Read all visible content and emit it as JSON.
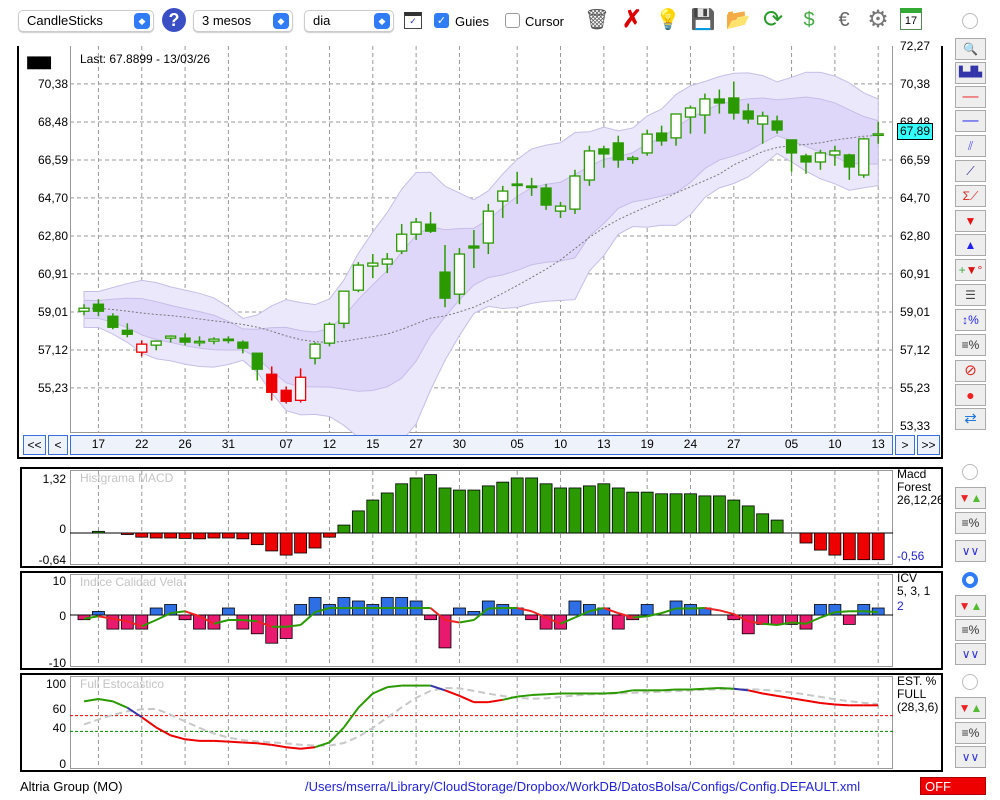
{
  "toolbar": {
    "chart_type": "CandleSticks",
    "period": "3 mesos",
    "interval": "dia",
    "guides_label": "Guies",
    "guides_checked": true,
    "cursor_label": "Cursor",
    "cursor_checked": false,
    "icons": [
      "trash-icon",
      "delete-icon",
      "lamp-icon",
      "save-icon",
      "open-folder-icon",
      "refresh-icon",
      "dollar-refresh-icon",
      "euro-icon",
      "gear-icon",
      "calendar-icon"
    ],
    "calendar_day": "17"
  },
  "main": {
    "last_label": "Last: 67.8899 - 13/03/26",
    "current_price": "67,89",
    "price_ticks": [
      72.27,
      70.38,
      68.48,
      66.59,
      64.7,
      62.8,
      60.91,
      59.01,
      57.12,
      55.23,
      53.33
    ],
    "price_tick_labels": [
      "72,27",
      "70,38",
      "68,48",
      "66,59",
      "64,70",
      "62,80",
      "60,91",
      "59,01",
      "57,12",
      "55,23",
      "53,33"
    ],
    "nav": {
      "first": "<<",
      "prev": "<",
      "next": ">",
      "last": ">>"
    },
    "date_ticks": [
      {
        "label": "17",
        "i": 1
      },
      {
        "label": "22",
        "i": 4
      },
      {
        "label": "26",
        "i": 7
      },
      {
        "label": "31",
        "i": 10
      },
      {
        "label": "07",
        "i": 14
      },
      {
        "label": "12",
        "i": 17
      },
      {
        "label": "15",
        "i": 20
      },
      {
        "label": "27",
        "i": 23
      },
      {
        "label": "30",
        "i": 26
      },
      {
        "label": "05",
        "i": 30
      },
      {
        "label": "10",
        "i": 33
      },
      {
        "label": "13",
        "i": 36
      },
      {
        "label": "19",
        "i": 39
      },
      {
        "label": "24",
        "i": 42
      },
      {
        "label": "27",
        "i": 45
      },
      {
        "label": "05",
        "i": 49
      },
      {
        "label": "10",
        "i": 52
      },
      {
        "label": "13",
        "i": 55
      }
    ]
  },
  "chart_data": {
    "type": "candlestick",
    "ylim": [
      53.33,
      72.27
    ],
    "colors": {
      "up": "#2a9a00",
      "down": "#ee0000",
      "band_outer": "#ece8fc",
      "band_inner": "#dfd7fa"
    },
    "candles": [
      [
        59.05,
        59.2,
        59.4,
        58.85,
        "g"
      ],
      [
        59.4,
        59.05,
        59.65,
        58.8,
        "g"
      ],
      [
        58.8,
        58.25,
        58.95,
        58.15,
        "g"
      ],
      [
        58.1,
        57.9,
        58.45,
        57.75,
        "g"
      ],
      [
        57.01,
        57.41,
        57.6,
        56.8,
        "r"
      ],
      [
        57.36,
        57.56,
        57.6,
        57.1,
        "g"
      ],
      [
        57.71,
        57.81,
        57.85,
        57.5,
        "g"
      ],
      [
        57.71,
        57.51,
        57.95,
        57.35,
        "g"
      ],
      [
        57.51,
        57.55,
        57.8,
        57.3,
        "g"
      ],
      [
        57.56,
        57.66,
        57.75,
        57.4,
        "g"
      ],
      [
        57.66,
        57.61,
        57.8,
        57.45,
        "g"
      ],
      [
        57.51,
        57.21,
        57.6,
        56.95,
        "g"
      ],
      [
        56.96,
        56.16,
        56.96,
        55.6,
        "g"
      ],
      [
        55.91,
        55.01,
        56.3,
        54.6,
        "r"
      ],
      [
        55.11,
        54.56,
        55.3,
        54.45,
        "r"
      ],
      [
        54.61,
        55.76,
        56.2,
        54.5,
        "r"
      ],
      [
        56.71,
        57.41,
        57.5,
        56.4,
        "g"
      ],
      [
        57.46,
        58.4,
        58.5,
        57.3,
        "g"
      ],
      [
        58.45,
        60.05,
        60.05,
        58.2,
        "g"
      ],
      [
        60.1,
        61.35,
        61.5,
        60.0,
        "g"
      ],
      [
        61.3,
        61.45,
        61.9,
        60.7,
        "g"
      ],
      [
        61.4,
        61.65,
        61.95,
        60.95,
        "g"
      ],
      [
        62.05,
        62.89,
        63.4,
        61.9,
        "g"
      ],
      [
        62.89,
        63.49,
        63.7,
        62.6,
        "g"
      ],
      [
        63.39,
        63.04,
        64.0,
        62.95,
        "g"
      ],
      [
        61.0,
        59.7,
        62.35,
        59.25,
        "g"
      ],
      [
        59.9,
        61.9,
        62.2,
        59.4,
        "g"
      ],
      [
        62.3,
        62.2,
        63.1,
        61.2,
        "g"
      ],
      [
        62.45,
        64.04,
        64.4,
        61.9,
        "g"
      ],
      [
        64.54,
        65.04,
        65.3,
        63.7,
        "g"
      ],
      [
        65.39,
        65.34,
        66.0,
        64.4,
        "g"
      ],
      [
        65.29,
        65.27,
        65.7,
        64.8,
        "g"
      ],
      [
        65.19,
        64.34,
        65.4,
        64.1,
        "g"
      ],
      [
        64.04,
        64.29,
        64.5,
        63.7,
        "g"
      ],
      [
        64.14,
        65.79,
        66.1,
        63.9,
        "g"
      ],
      [
        65.59,
        67.04,
        67.3,
        65.3,
        "g"
      ],
      [
        67.14,
        66.89,
        67.3,
        66.2,
        "g"
      ],
      [
        67.44,
        66.59,
        67.8,
        66.2,
        "g"
      ],
      [
        66.64,
        66.69,
        66.8,
        66.4,
        "g"
      ],
      [
        66.94,
        67.88,
        68.1,
        66.8,
        "g"
      ],
      [
        67.93,
        67.54,
        68.3,
        67.3,
        "g"
      ],
      [
        67.69,
        68.88,
        68.9,
        67.3,
        "g"
      ],
      [
        68.73,
        69.18,
        69.3,
        67.9,
        "g"
      ],
      [
        68.83,
        69.63,
        69.9,
        67.9,
        "g"
      ],
      [
        69.63,
        69.43,
        70.1,
        68.9,
        "g"
      ],
      [
        69.68,
        68.93,
        70.5,
        68.6,
        "g"
      ],
      [
        69.03,
        68.63,
        69.4,
        68.4,
        "g"
      ],
      [
        68.38,
        68.78,
        69.0,
        67.4,
        "g"
      ],
      [
        68.53,
        68.08,
        68.8,
        67.9,
        "g"
      ],
      [
        67.59,
        66.94,
        67.6,
        66.0,
        "g"
      ],
      [
        66.79,
        66.49,
        66.9,
        65.9,
        "g"
      ],
      [
        66.49,
        66.94,
        67.1,
        66.1,
        "g"
      ],
      [
        66.84,
        67.04,
        67.3,
        66.3,
        "g"
      ],
      [
        66.84,
        66.24,
        66.9,
        65.6,
        "g"
      ],
      [
        65.84,
        67.64,
        67.7,
        65.7,
        "g"
      ],
      [
        67.89,
        67.89,
        68.5,
        67.4,
        "g"
      ]
    ],
    "macd": {
      "title": "Histgrama MACD",
      "side": "Macd\nForest\n26,12,26",
      "value": "-0,56",
      "ylim": [
        -0.64,
        1.32
      ],
      "tick_labels": [
        "1,32",
        "0",
        "-0,64"
      ],
      "values": [
        0,
        0.04,
        0,
        -0.01,
        -0.1,
        -0.12,
        -0.12,
        -0.13,
        -0.14,
        -0.12,
        -0.12,
        -0.14,
        -0.28,
        -0.43,
        -0.53,
        -0.48,
        -0.36,
        -0.1,
        0.19,
        0.53,
        0.79,
        0.96,
        1.18,
        1.32,
        1.4,
        1.08,
        1.03,
        1.03,
        1.13,
        1.22,
        1.32,
        1.32,
        1.18,
        1.08,
        1.08,
        1.13,
        1.18,
        1.08,
        0.98,
        0.98,
        0.94,
        0.94,
        0.94,
        0.89,
        0.89,
        0.79,
        0.65,
        0.46,
        0.31,
        0,
        -0.24,
        -0.41,
        -0.53,
        -0.64,
        -0.64,
        -0.64
      ]
    },
    "icv": {
      "title": "Indice Calidad Vela",
      "side": "ICV\n5, 3, 1",
      "value": "2",
      "ylim": [
        -10,
        10
      ],
      "tick_labels": [
        "10",
        "0",
        "-10"
      ],
      "values": [
        -1,
        1,
        -3,
        -3,
        -3,
        2,
        3,
        -1,
        -3,
        -3,
        2,
        -3,
        -4,
        -6,
        -5,
        3,
        5,
        3,
        5,
        4,
        3,
        5,
        5,
        4,
        -1,
        -7,
        2,
        1,
        4,
        3,
        2,
        -1,
        -3,
        -3,
        4,
        3,
        2,
        -3,
        -1,
        3,
        0,
        4,
        3,
        2,
        0,
        -1,
        -4,
        -2,
        -2,
        -2,
        -3,
        3,
        3,
        -2,
        3,
        2
      ]
    },
    "stoch": {
      "title": "Full Estocastico",
      "side": "EST. %\nFULL\n(28,3,6)",
      "ylim": [
        0,
        100
      ],
      "tick_labels": [
        "100",
        "60",
        "40",
        "0"
      ],
      "levels": [
        60,
        40
      ],
      "k": [
        78,
        81,
        78,
        70,
        58,
        45,
        35,
        30,
        28,
        28,
        27,
        26,
        25,
        23,
        20,
        18,
        20,
        26,
        45,
        70,
        88,
        96,
        98,
        98,
        98,
        92,
        85,
        77,
        77,
        80,
        84,
        86,
        87,
        88,
        88,
        88,
        88,
        89,
        92,
        92,
        92,
        93,
        93,
        94,
        95,
        94,
        92,
        88,
        85,
        82,
        79,
        76,
        74,
        73,
        73,
        73
      ]
    }
  },
  "footer": {
    "name": "Altria Group (MO)",
    "path": "/Users/mserra/Library/CloudStorage/Dropbox/WorkDB/DatosBolsa/Configs/Config.DEFAULT.xml",
    "status": "OFF"
  }
}
